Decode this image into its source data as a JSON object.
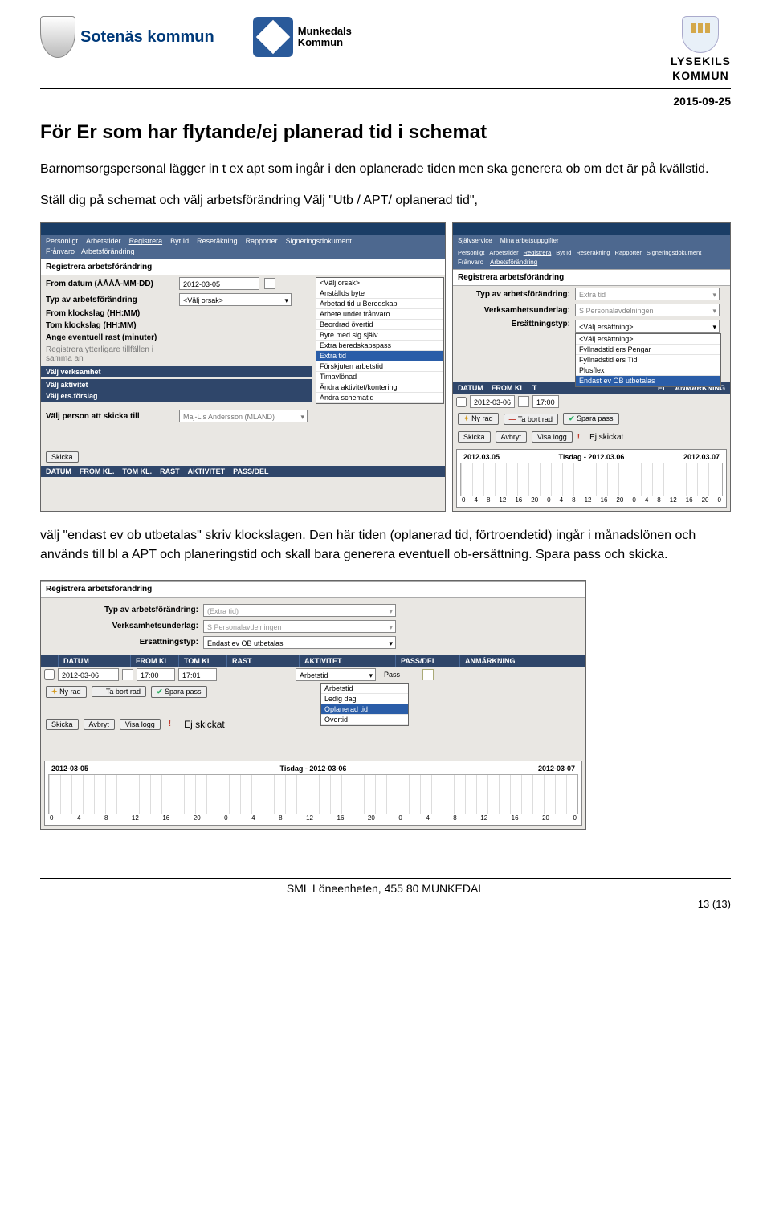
{
  "header": {
    "sotenas": "Sotenäs kommun",
    "munkedal_line1": "Munkedals",
    "munkedal_line2": "Kommun",
    "lysekil_line1": "LYSEKILS",
    "lysekil_line2": "KOMMUN",
    "date": "2015-09-25"
  },
  "title": "För Er som har flytande/ej planerad tid i schemat",
  "para1": "Barnomsorgspersonal lägger in t ex apt som ingår i den oplanerade tiden men ska generera ob om det är på kvällstid.",
  "para2": "Ställ dig på schemat och välj arbetsförändring Välj \"Utb / APT/ oplanerad tid\",",
  "para3": "välj \"endast ev ob utbetalas\" skriv klockslagen. Den här tiden (oplanerad tid, förtroendetid) ingår i månadslönen och används till bl a APT och planeringstid och skall bara generera eventuell ob-ersättning. Spara pass och skicka.",
  "left_shot": {
    "heading": "Registrera arbetsförändring",
    "tabs": [
      "Personligt",
      "Arbetstider",
      "Registrera",
      "Byt Id",
      "Reseräkning",
      "Rapporter",
      "Signeringsdokument"
    ],
    "subtabs": [
      "Frånvaro",
      "Arbetsförändring"
    ],
    "rows": {
      "r1": {
        "label": "From datum (ÅÅÅÅ-MM-DD)",
        "value": "2012-03-05"
      },
      "r2": {
        "label": "Typ av arbetsförändring",
        "value": "<Välj orsak>"
      },
      "r3": {
        "label": "From klockslag (HH:MM)",
        "value": ""
      },
      "r4": {
        "label": "Tom klockslag (HH:MM)",
        "value": ""
      },
      "r5": {
        "label": "Ange eventuell rast (minuter)",
        "value": ""
      },
      "r6": {
        "label": "Registrera ytterligare tillfällen i samma an",
        "value": ""
      },
      "r7": {
        "label": "Välj verksamhet",
        "value": ""
      },
      "r8": {
        "label": "Välj aktivitet",
        "value": ""
      },
      "r9": {
        "label": "Välj ers.förslag",
        "value": ""
      },
      "r10": {
        "label": "Välj person att skicka till",
        "value": "Maj-Lis Andersson (MLAND)"
      }
    },
    "dropdown": [
      "<Välj orsak>",
      "Anställds byte",
      "Arbetad tid u Beredskap",
      "Arbete under frånvaro",
      "Beordrad övertid",
      "Byte med sig själv",
      "Extra beredskapspass",
      "Extra tid",
      "Förskjuten arbetstid",
      "Timavlönad",
      "Ändra aktivitet/kontering",
      "Ändra schematid"
    ],
    "dropdown_sel": "Extra tid",
    "btn_skicka": "Skicka",
    "table_head": [
      "DATUM",
      "FROM KL.",
      "TOM KL.",
      "RAST",
      "AKTIVITET",
      "PASS/DEL"
    ]
  },
  "right_shot": {
    "tabs": [
      "Självservice",
      "Mina arbetsuppgifter"
    ],
    "tabs2": [
      "Personligt",
      "Arbetstider",
      "Registrera",
      "Byt Id",
      "Reseräkning",
      "Rapporter",
      "Signeringsdokument"
    ],
    "subtabs": [
      "Frånvaro",
      "Arbetsförändring"
    ],
    "heading": "Registrera arbetsförändring",
    "r1": {
      "label": "Typ av arbetsförändring:",
      "value": "Extra tid"
    },
    "r2": {
      "label": "Verksamhetsunderlag:",
      "value": "S Personalavdelningen"
    },
    "r3": {
      "label": "Ersättningstyp:",
      "value": "<Välj ersättning>"
    },
    "ers_options": [
      "<Välj ersättning>",
      "Fyllnadstid ers Pengar",
      "Fyllnadstid ers Tid",
      "Plusflex",
      "Endast ev OB utbetalas"
    ],
    "ers_sel": "Endast ev OB utbetalas",
    "table_head": [
      "DATUM",
      "FROM KL",
      "T",
      "EL",
      "ANMÄRKNING"
    ],
    "row_date": "2012-03-06",
    "row_from": "17:00",
    "btns": {
      "ny": "Ny rad",
      "ta": "Ta bort rad",
      "spara": "Spara pass"
    },
    "btns2": {
      "skicka": "Skicka",
      "avbryt": "Avbryt",
      "visa": "Visa logg"
    },
    "ej": "Ej skickat",
    "chart_dates": [
      "2012.03.05",
      "Tisdag - 2012.03.06",
      "2012.03.07"
    ],
    "ticks": [
      "0",
      "4",
      "8",
      "12",
      "16",
      "20",
      "0",
      "4",
      "8",
      "12",
      "16",
      "20",
      "0",
      "4",
      "8",
      "12",
      "16",
      "20",
      "0"
    ]
  },
  "big_shot": {
    "heading": "Registrera arbetsförändring",
    "r1": {
      "label": "Typ av arbetsförändring:",
      "value": "(Extra tid)"
    },
    "r2": {
      "label": "Verksamhetsunderlag:",
      "value": "S Personalavdelningen"
    },
    "r3": {
      "label": "Ersättningstyp:",
      "value": "Endast ev OB utbetalas"
    },
    "table_head": [
      "DATUM",
      "FROM KL",
      "TOM KL",
      "RAST",
      "AKTIVITET",
      "PASS/DEL",
      "ANMÄRKNING"
    ],
    "row_date": "2012-03-06",
    "row_from": "17:00",
    "row_tom": "17:01",
    "row_aktivitet": "Arbetstid",
    "row_pass": "Pass",
    "aktivitet_options": [
      "Arbetstid",
      "Ledig dag",
      "Oplanerad tid",
      "Övertid"
    ],
    "aktivitet_sel": "Oplanerad tid",
    "btns": {
      "ny": "Ny rad",
      "ta": "Ta bort rad",
      "spara": "Spara pass"
    },
    "btns2": {
      "skicka": "Skicka",
      "avbryt": "Avbryt",
      "visa": "Visa logg"
    },
    "ej": "Ej skickat",
    "chart_dates": [
      "2012-03-05",
      "Tisdag - 2012-03-06",
      "2012-03-07"
    ],
    "ticks": [
      "0",
      "4",
      "8",
      "12",
      "16",
      "20",
      "0",
      "4",
      "8",
      "12",
      "16",
      "20",
      "0",
      "4",
      "8",
      "12",
      "16",
      "20",
      "0"
    ]
  },
  "footer": {
    "line": "SML Löneenheten, 455 80 MUNKEDAL",
    "page": "13 (13)"
  }
}
